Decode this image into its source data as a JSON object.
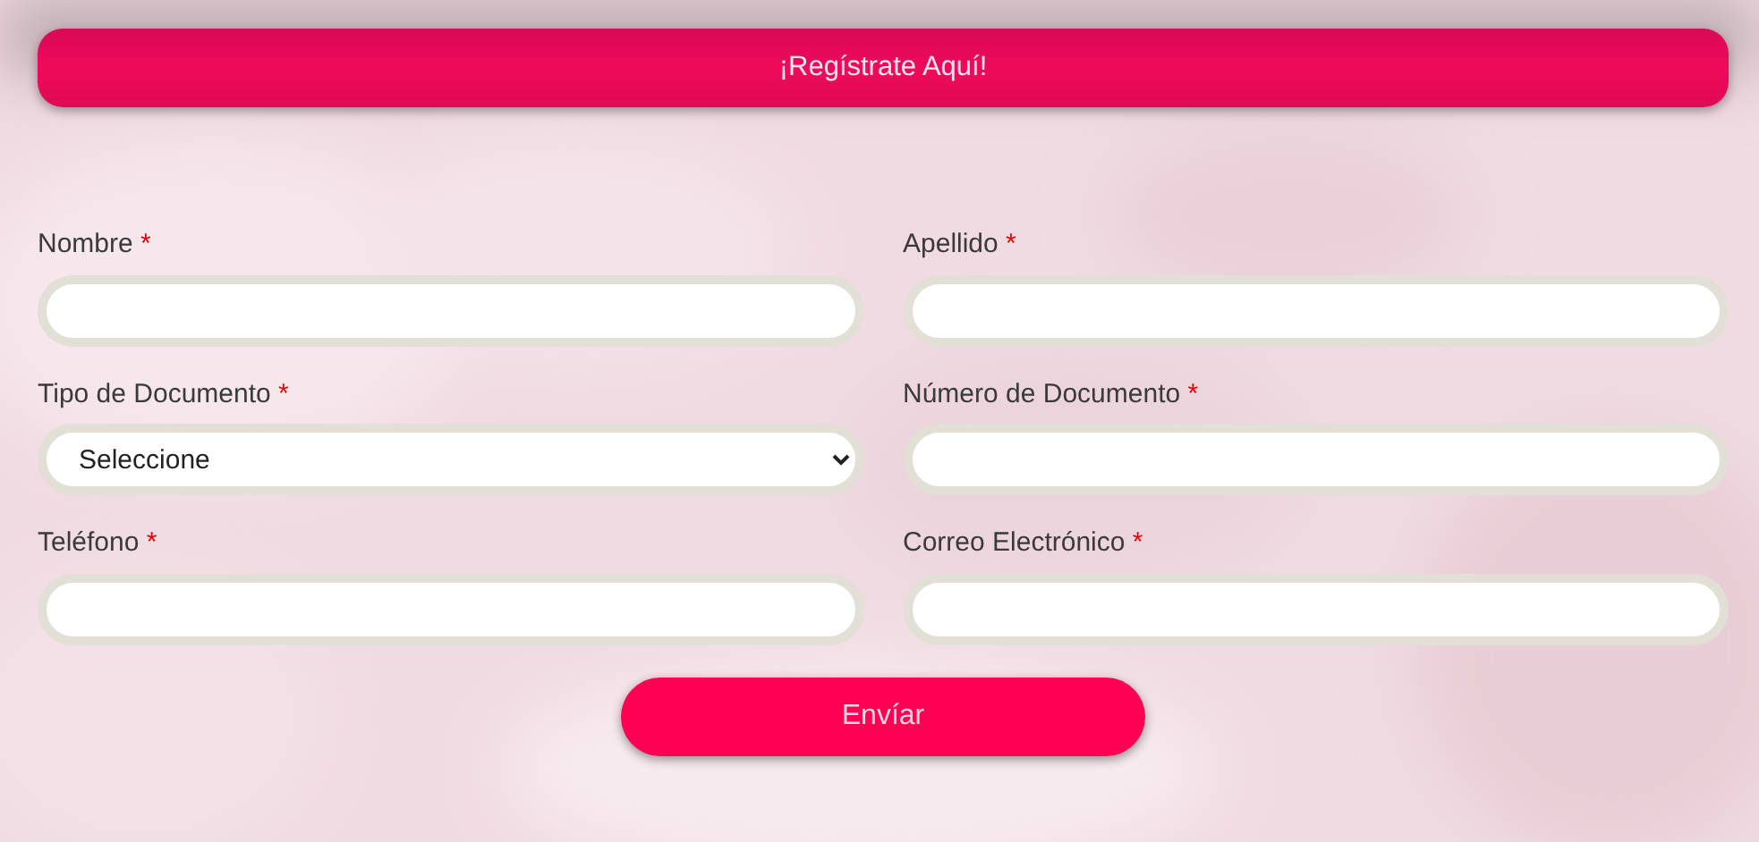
{
  "header": {
    "title": "¡Regístrate Aquí!"
  },
  "fields": [
    {
      "label": "Nombre",
      "required_mark": "*",
      "kind": "text"
    },
    {
      "label": "Apellido",
      "required_mark": "*",
      "kind": "text"
    },
    {
      "label": "Tipo de Documento",
      "required_mark": "*",
      "kind": "select",
      "value": "Seleccione"
    },
    {
      "label": "Número de Documento",
      "required_mark": "*",
      "kind": "text"
    },
    {
      "label": "Teléfono",
      "required_mark": "*",
      "kind": "text"
    },
    {
      "label": "Correo Electrónico",
      "required_mark": "*",
      "kind": "text"
    }
  ],
  "submit": {
    "label": "Envíar"
  }
}
